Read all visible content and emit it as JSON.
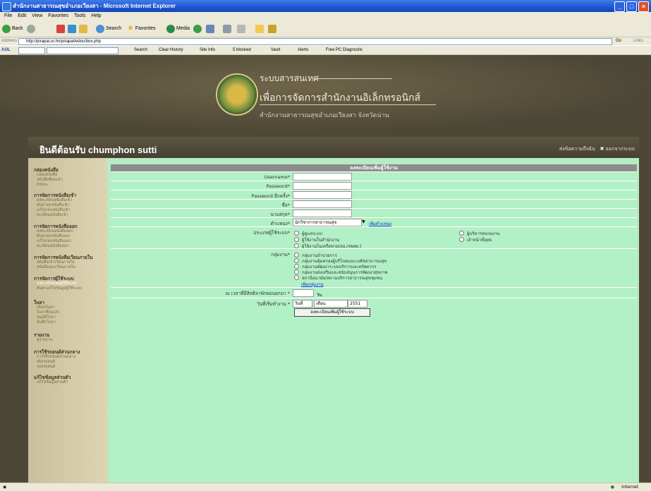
{
  "window": {
    "title": "สำนักงานสาธารณสุขอำเภอเวียงสา - Microsoft Internet Explorer"
  },
  "menu": [
    "File",
    "Edit",
    "View",
    "Favorites",
    "Tools",
    "Help"
  ],
  "toolbar": {
    "back": "Back",
    "search": "Search",
    "favorites": "Favorites",
    "media": "Media"
  },
  "address": {
    "label": "Address",
    "url": "http://pirapat.or.hn/pirapat/edoc/box.php",
    "go": "Go",
    "links": "Links"
  },
  "aol": {
    "label": "AOL",
    "search": "Search",
    "clear_history": "Clear History",
    "site_info": "Site Info",
    "blocked": "5 blocked",
    "vault": "Vault",
    "alerts": "Alerts",
    "free_pc": "Free PC Diagnostic"
  },
  "banner": {
    "line1": "ระบบสารสนเทศ",
    "line2": "เพื่อการจัดการสำนักงานอิเล็กทรอนิกส์",
    "line3": "สำนักงานสาธารณสุขอำเภอเวียงสา จังหวัดน่าน"
  },
  "welcome": {
    "text": "ยินดีต้อนรับ chumphon sutti",
    "inbox": "ส่งข้อความถึงฉัน",
    "logout": "ออกจากระบบ"
  },
  "sidebar": [
    {
      "title": "กล่องหนังสือ",
      "items": [
        "กล่องหนังสือ",
        "หนังสือที่ส่งแล้ว",
        "ถังขยะ"
      ]
    },
    {
      "title": "การจัดการหนังสือเข้า",
      "items": [
        "ลงทะเบียนหนังสือเข้า",
        "ค้นหาทุกหนังสือเข้า",
        "แก้ไข/ลบหนังสือเข้า",
        "ทะเบียนหนังสือเข้า"
      ]
    },
    {
      "title": "การจัดการหนังสือออก",
      "items": [
        "ลงทะเบียนหนังสือออก",
        "ค้นหาทุกหนังสือออก",
        "แก้ไข/ลบหนังสือออก",
        "ทะเบียนหนังสือออก"
      ]
    },
    {
      "title": "การจัดการหนังสือเวียนภายใน",
      "items": [
        "หนังสือเข้าเวียนภายใน",
        "หนังสือออกเวียนภายใน"
      ]
    },
    {
      "title": "การจัดการผู้ใช้ระบบ",
      "items": [
        "ลงทะเบียนเพิ่มผู้ใช้ระบบ",
        "ค้นหาแก้ไขข้อมูลผู้ใช้ระบบ"
      ]
    },
    {
      "title": "ใบลา",
      "items": [
        "เขียนใบลา",
        "ใบลาที่ส่งแล้ว",
        "อนุมัติใบลา",
        "บันทึกใบลา"
      ]
    },
    {
      "title": "รายงาน",
      "items": [
        "ดูรายงาน"
      ]
    },
    {
      "title": "การใช้รถยนต์ส่วนกลาง",
      "items": [
        "การใช้รถยนต์ส่วนกลาง",
        "เพิ่มรถยนต์",
        "จองรถยนต์"
      ]
    },
    {
      "title": "แก้ไขข้อมูลส่วนตัว",
      "items": [
        "แก้ไขข้อมูลส่วนตัว"
      ]
    }
  ],
  "form": {
    "header": "ลงทะเบียนเพิ่มผู้ใช้งาน",
    "username": "Username*",
    "password": "Password*",
    "password_confirm": "Password อีกครั้ง*",
    "first_name": "ชื่อ*",
    "last_name": "นามสกุล*",
    "position_label": "ตำแหน่ง*",
    "position_value": "นักวิชาการสาธารณสุข",
    "add_position": "เพิ่มตำแหน่ง",
    "user_type_label": "ประเภทผู้ใช้ระบบ*",
    "user_types": [
      "ผู้ดูแลระบบ",
      "ผู้ใช้งานในสำนักงาน",
      "ผู้ใช้งานในเครือข่าย(สอ./รพสต.)"
    ],
    "user_types_right": [
      "ผู้บริหารหน่วยงาน",
      "เจ้าหน้าที่ยุทธ"
    ],
    "group_label": "กลุ่มงาน*",
    "groups": [
      "กลุ่มงานอำนวยการ",
      "กลุ่มงานคุ้มครองผู้บริโภคและเภสัชสาธารณสุข",
      "กลุ่มงานพัฒนาระบบบริการและทรัพยากร",
      "กลุ่มงานส่งเสริมและสนับสนุนการพัฒนาสุขภาพ",
      "สถานีอนามัย/สถานบริการสาธารณสุขชุมชน"
    ],
    "add_group": "เพิ่มกลุ่มงาน",
    "days_label": "ณ เวลาที่มีสิทธิลาพักผ่อนยกมา *",
    "days_unit": "วัน",
    "start_label": "วันที่เริ่มทำงาน *",
    "day": "วันที่",
    "month": "เดือน",
    "year": "2551",
    "submit": "ลงทะเบียนเพิ่มผู้ใช้ระบบ"
  },
  "status": {
    "zone": "Internet"
  }
}
